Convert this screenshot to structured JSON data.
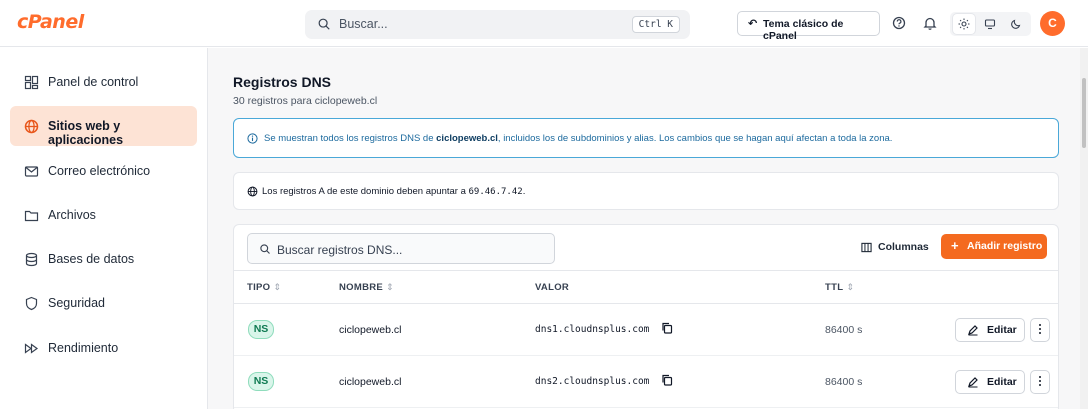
{
  "header": {
    "logo": "cPanel",
    "search_placeholder": "Buscar...",
    "search_shortcut": "Ctrl K",
    "classic_theme_label": "Tema clásico de cPanel",
    "avatar_initial": "C",
    "icons": [
      "help-icon",
      "bell-icon",
      "sun-icon",
      "monitor-icon",
      "moon-icon"
    ]
  },
  "sidebar": {
    "items": [
      {
        "label": "Panel de control",
        "icon": "dashboard-icon"
      },
      {
        "label": "Sitios web y aplicaciones",
        "icon": "globe-icon",
        "active": true
      },
      {
        "label": "Correo electrónico",
        "icon": "mail-icon"
      },
      {
        "label": "Archivos",
        "icon": "folder-icon"
      },
      {
        "label": "Bases de datos",
        "icon": "database-icon"
      },
      {
        "label": "Seguridad",
        "icon": "shield-icon"
      },
      {
        "label": "Rendimiento",
        "icon": "fast-forward-icon"
      }
    ]
  },
  "main": {
    "title": "Registros DNS",
    "subtitle": "30 registros para ciclopeweb.cl",
    "info": {
      "before": "Se muestran todos los registros DNS de ",
      "domain": "ciclopeweb.cl",
      "after": ", incluidos los de subdominios y alias. Los cambios que se hagan aquí afectan a toda la zona."
    },
    "note": {
      "text": "Los registros A de este dominio deben apuntar a ",
      "ip": "69.46.7.42",
      "end": "."
    },
    "table": {
      "search_placeholder": "Buscar registros DNS...",
      "columns_label": "Columnas",
      "add_label": "Añadir registro",
      "headers": {
        "type": "TIPO",
        "name": "NOMBRE",
        "value": "VALOR",
        "ttl": "TTL"
      },
      "rows": [
        {
          "type": "NS",
          "name": "ciclopeweb.cl",
          "value": "dns1.cloudnsplus.com",
          "ttl": "86400 s",
          "edit": "Editar"
        },
        {
          "type": "NS",
          "name": "ciclopeweb.cl",
          "value": "dns2.cloudnsplus.com",
          "ttl": "86400 s",
          "edit": "Editar"
        }
      ]
    }
  },
  "colors": {
    "accent": "#f46a1f",
    "brand": "#ff6c2c",
    "info_border": "#4aa8d8",
    "ns_badge": "#d9f5ea"
  }
}
